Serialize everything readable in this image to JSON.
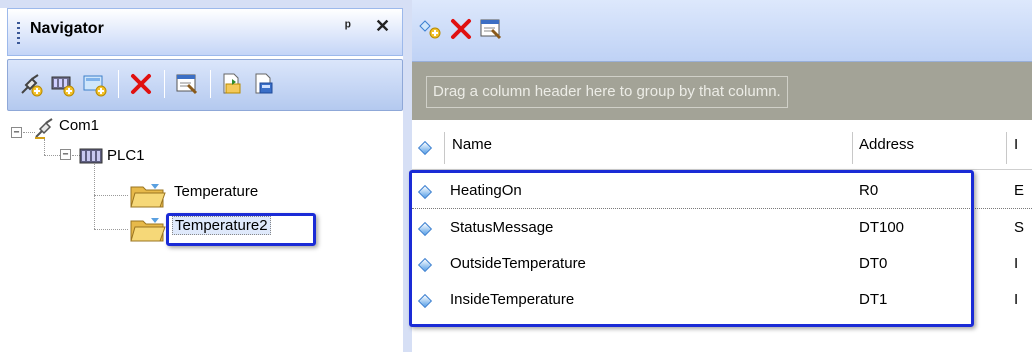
{
  "navigator": {
    "title": "Navigator",
    "pin_label": "ᵖ",
    "close_label": "✕",
    "toolbar": [
      {
        "icon": "add-com-port-icon"
      },
      {
        "icon": "add-plc-icon"
      },
      {
        "icon": "add-group-icon"
      },
      {
        "icon": "delete-icon"
      },
      {
        "icon": "properties-icon"
      },
      {
        "icon": "import-icon"
      },
      {
        "icon": "export-icon"
      }
    ],
    "tree": {
      "root": {
        "label": "Com1",
        "expander": "−"
      },
      "plc": {
        "label": "PLC1",
        "expander": "−"
      },
      "groups": [
        {
          "label": "Temperature"
        },
        {
          "label": "Temperature2"
        }
      ]
    }
  },
  "grid": {
    "toolbar": [
      {
        "icon": "add-variable-icon"
      },
      {
        "icon": "delete-icon"
      },
      {
        "icon": "edit-icon"
      }
    ],
    "group_hint": "Drag a column header here to group by that column.",
    "columns": [
      "Name",
      "Address",
      "I"
    ],
    "rows": [
      {
        "name": "HeatingOn",
        "address": "R0",
        "next": "E"
      },
      {
        "name": "StatusMessage",
        "address": "DT100",
        "next": "S"
      },
      {
        "name": "OutsideTemperature",
        "address": "DT0",
        "next": "I"
      },
      {
        "name": "InsideTemperature",
        "address": "DT1",
        "next": "I"
      }
    ]
  },
  "colors": {
    "highlight": "#1a2bd6",
    "delete_red": "#e01010",
    "group_area": "#a3a397",
    "toolbar_blue": "#c4d5f7"
  }
}
